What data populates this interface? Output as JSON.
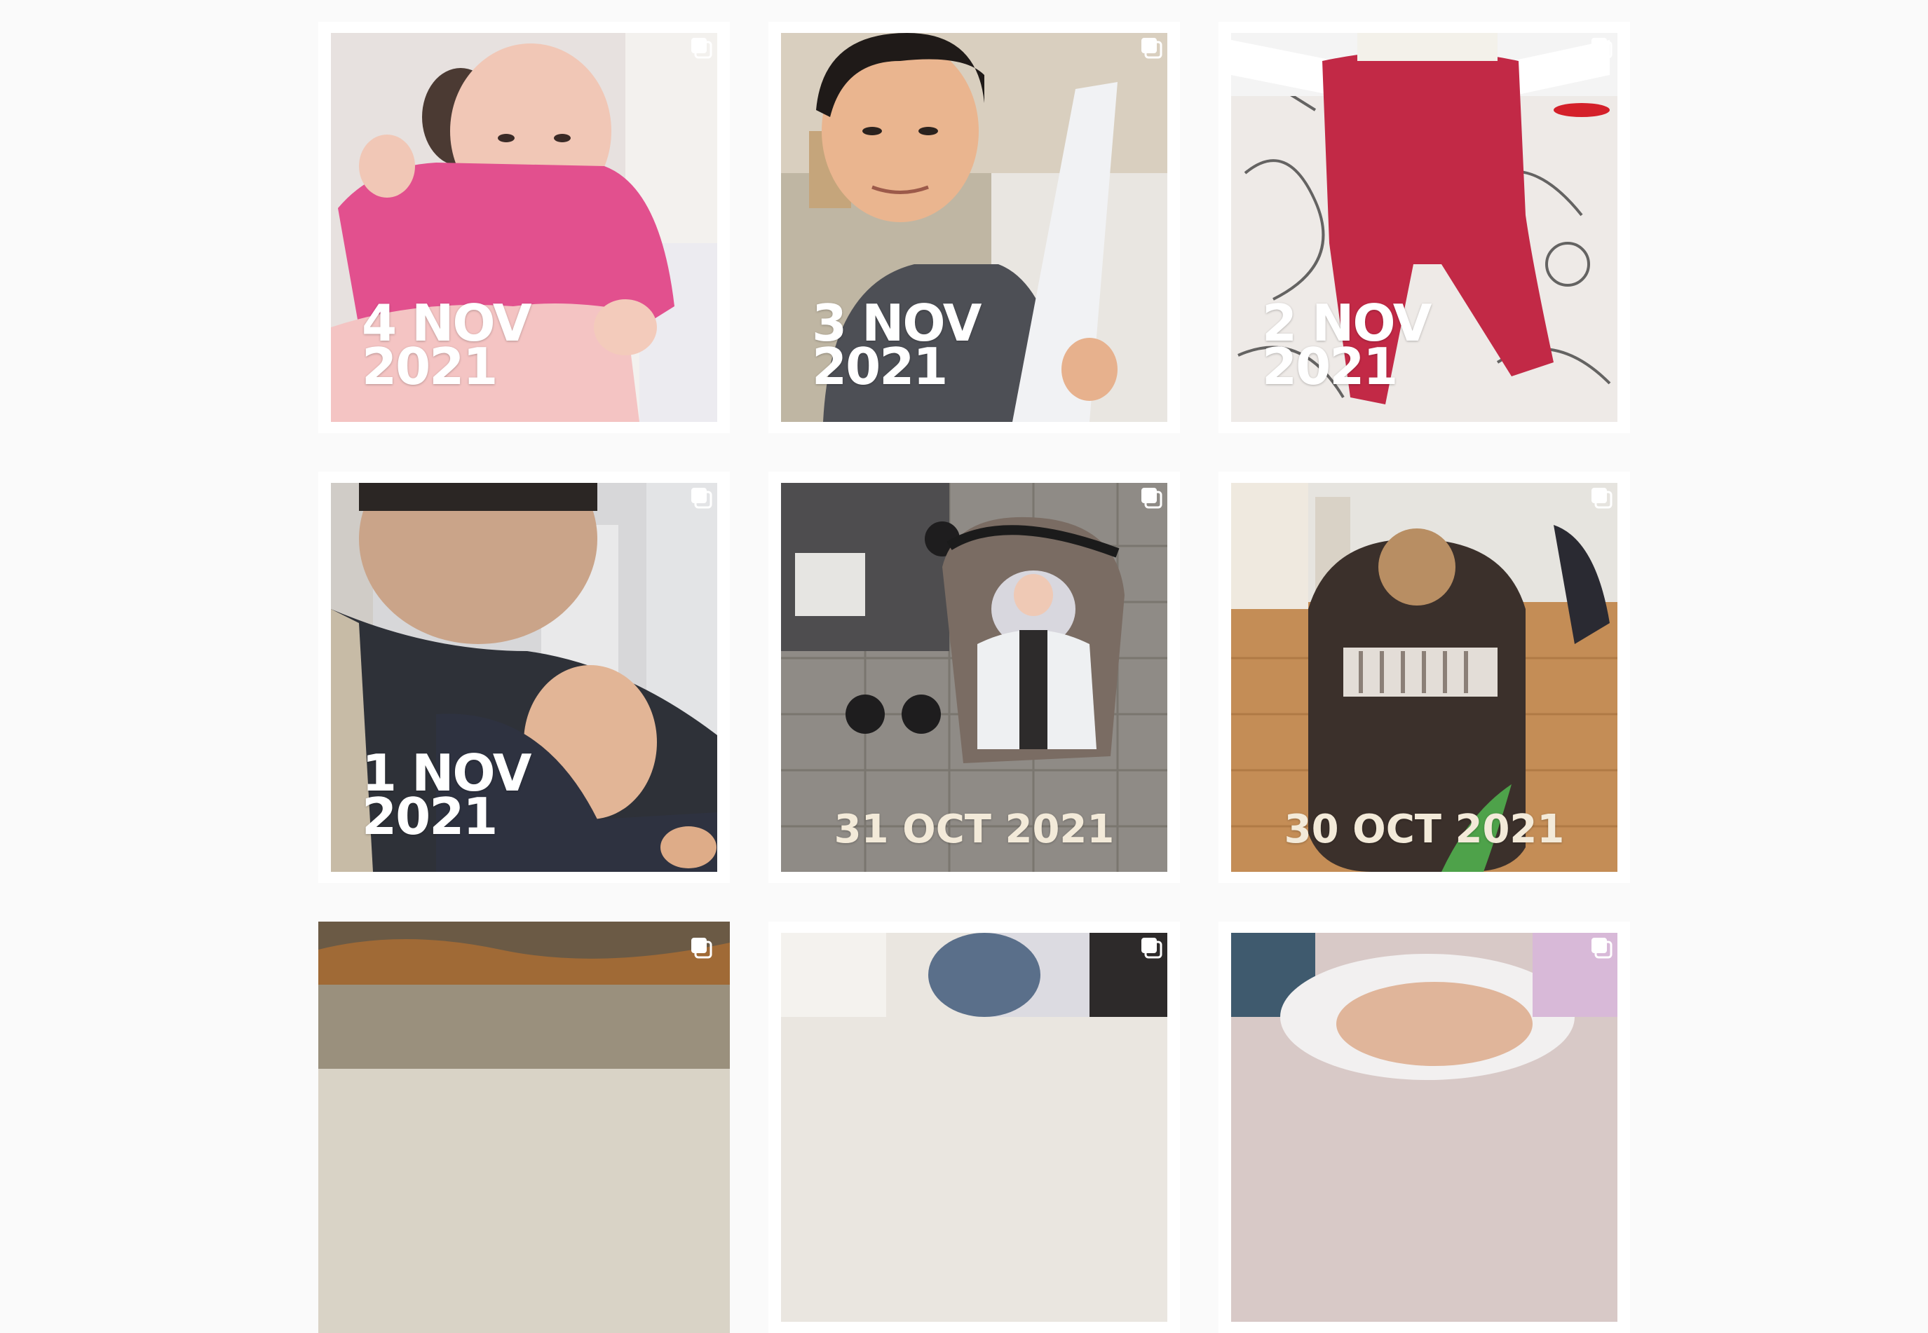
{
  "posts": [
    {
      "caption": "4 NOV\n2021",
      "icon": "carousel-icon"
    },
    {
      "caption": "3 NOV\n2021",
      "icon": "carousel-icon"
    },
    {
      "caption": "2 NOV\n2021",
      "icon": "carousel-icon"
    },
    {
      "caption": "1 NOV\n2021",
      "icon": "carousel-icon"
    },
    {
      "caption": "31 OCT 2021",
      "icon": "carousel-icon"
    },
    {
      "caption": "30 OCT 2021",
      "icon": "carousel-icon"
    },
    {
      "caption": "",
      "icon": "carousel-icon"
    },
    {
      "caption": "",
      "icon": "carousel-icon"
    },
    {
      "caption": "",
      "icon": "carousel-icon"
    }
  ]
}
